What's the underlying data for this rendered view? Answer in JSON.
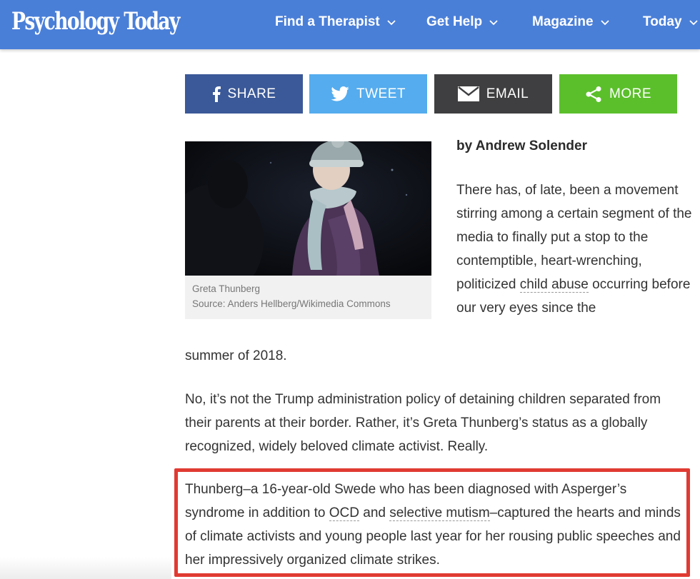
{
  "header": {
    "logo": "Psychology Today",
    "nav": [
      {
        "label": "Find a Therapist"
      },
      {
        "label": "Get Help"
      },
      {
        "label": "Magazine"
      },
      {
        "label": "Today"
      }
    ]
  },
  "share": {
    "facebook": "SHARE",
    "twitter": "TWEET",
    "email": "EMAIL",
    "more": "MORE"
  },
  "figure": {
    "caption": "Greta Thunberg",
    "source": "Source: Anders Hellberg/Wikimedia Commons"
  },
  "article": {
    "byline": "by Andrew Solender",
    "intro_before": "There has, of late, been a movement stirring among a certain segment of the media to finally put a stop to the contemptible, heart-wrenching, politicized ",
    "intro_link": "child abuse",
    "intro_after": " occurring before our very eyes since the",
    "intro_continued": "summer of 2018.",
    "p2": "No, it’s not the Trump administration policy of detaining children separated from their parents at their border. Rather, it’s Greta Thunberg’s status as a globally recognized, widely beloved climate activist. Really.",
    "p3_a": "Thunberg–a 16-year-old Swede who has been diagnosed with Asperger’s syndrome in addition to ",
    "p3_link1": "OCD",
    "p3_b": " and ",
    "p3_link2": "selective mutism",
    "p3_c": "–captured the hearts and minds of climate activists and young people last year for her rousing public speeches and her impressively organized climate strikes."
  },
  "icons": {
    "facebook": "facebook-icon",
    "twitter": "twitter-icon",
    "email": "email-icon",
    "more": "share-icon",
    "chevron": "chevron-down-icon"
  },
  "colors": {
    "header": "#4a7fd8",
    "facebook": "#3b5998",
    "twitter": "#55acee",
    "email": "#3f3f41",
    "more": "#5bbf2b",
    "highlight": "#e03a32"
  }
}
